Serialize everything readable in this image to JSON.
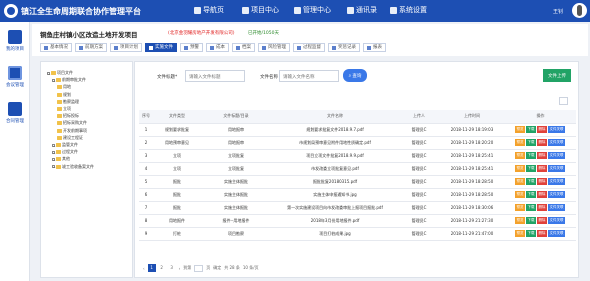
{
  "header": {
    "app_title": "镇江全生命周期联合协作管理平台",
    "nav": [
      "导航页",
      "项目中心",
      "管理中心",
      "通讯录",
      "系统设置"
    ],
    "user_name": "王钊"
  },
  "rail": [
    "我的项目",
    "会议管理",
    "合同管理"
  ],
  "project": {
    "title": "铜鱼庄村镇小区改造土地开发项目",
    "org": "(北京金羽耀房地产开发有限公司)",
    "status": "已开始/1050天",
    "tabs": [
      "基本情况",
      "前期方案",
      "项目计划",
      "实施文件",
      "预警",
      "成本",
      "档案",
      "风险管理",
      "过程监督",
      "奖惩记录",
      "报表"
    ],
    "active_tab_index": 3
  },
  "tree": [
    {
      "label": "项目文件",
      "level": 0
    },
    {
      "label": "前期审批文件",
      "level": 1
    },
    {
      "label": "用地",
      "level": 2
    },
    {
      "label": "规划",
      "level": 2
    },
    {
      "label": "勘察监理",
      "level": 2
    },
    {
      "label": "立项",
      "level": 2
    },
    {
      "label": "招标投标",
      "level": 2
    },
    {
      "label": "招标采购文件",
      "level": 2
    },
    {
      "label": "开发前期事项",
      "level": 2
    },
    {
      "label": "建设工程证",
      "level": 2
    },
    {
      "label": "监管文件",
      "level": 1
    },
    {
      "label": "过程文件",
      "level": 1
    },
    {
      "label": "其他",
      "level": 1
    },
    {
      "label": "竣工验收备案文件",
      "level": 1
    }
  ],
  "filters": {
    "label1": "文件标题*",
    "placeholder1": "请输入文件标题",
    "label2": "文件名称",
    "placeholder2": "请输入文件名称",
    "search_label": "查询",
    "upload_label": "文件上传"
  },
  "table": {
    "headers": [
      "序号",
      "文件类型",
      "文件标题/目录",
      "文件名称",
      "上传人",
      "上传时间",
      "操作"
    ],
    "rows": [
      [
        "1",
        "规划要求批复",
        "用地报审",
        "规划要求批复文件2018.9.7.pdf",
        "管理员C",
        "2018-11-29 18:19:03"
      ],
      [
        "2",
        "用地预审意见",
        "用地报审",
        "市规划局预审意见附件用地性质确定.pdf",
        "管理员C",
        "2018-11-29 18:20:20"
      ],
      [
        "3",
        "立项",
        "立项批复",
        "项目立项文件批复2018.9.9.pdf",
        "管理员C",
        "2018-11-29 18:25:41"
      ],
      [
        "4",
        "立项",
        "立项批复",
        "市发改委立项批复意见.pdf",
        "管理员C",
        "2018-11-29 18:25:41"
      ],
      [
        "5",
        "报批",
        "实施主体报批",
        "报批批复20180315.pdf",
        "管理员C",
        "2018-11-29 18:28:50"
      ],
      [
        "6",
        "报批",
        "实施主体报批",
        "实施主体申报通知书.jpg",
        "管理员C",
        "2018-11-29 18:28:50"
      ],
      [
        "7",
        "报批",
        "实施主体报批",
        "第一次实施建设项目向市发改委审批上报项目报批.pdf",
        "管理员C",
        "2018-11-29 18:30:06"
      ],
      [
        "8",
        "用地报件",
        "报件--用地报件",
        "2018年3月份用地报件.pdf",
        "管理员C",
        "2018-11-29 21:27:30"
      ],
      [
        "9",
        "打桩",
        "项目勘察",
        "项目打桩成果.jpg",
        "管理员C",
        "2018-11-29 21:47:00"
      ]
    ],
    "actions": [
      {
        "label": "预览",
        "color": "#f3a12b"
      },
      {
        "label": "下载",
        "color": "#21a366"
      },
      {
        "label": "删除",
        "color": "#e0413a"
      },
      {
        "label": "文件关联",
        "color": "#3a78e8"
      }
    ]
  },
  "pager": {
    "pages": [
      "1",
      "2",
      "3"
    ],
    "goto_label": "到第",
    "page_unit_label": "页",
    "confirm_label": "确定",
    "total_label": "共 28 条",
    "size_label": "10 条/页"
  }
}
